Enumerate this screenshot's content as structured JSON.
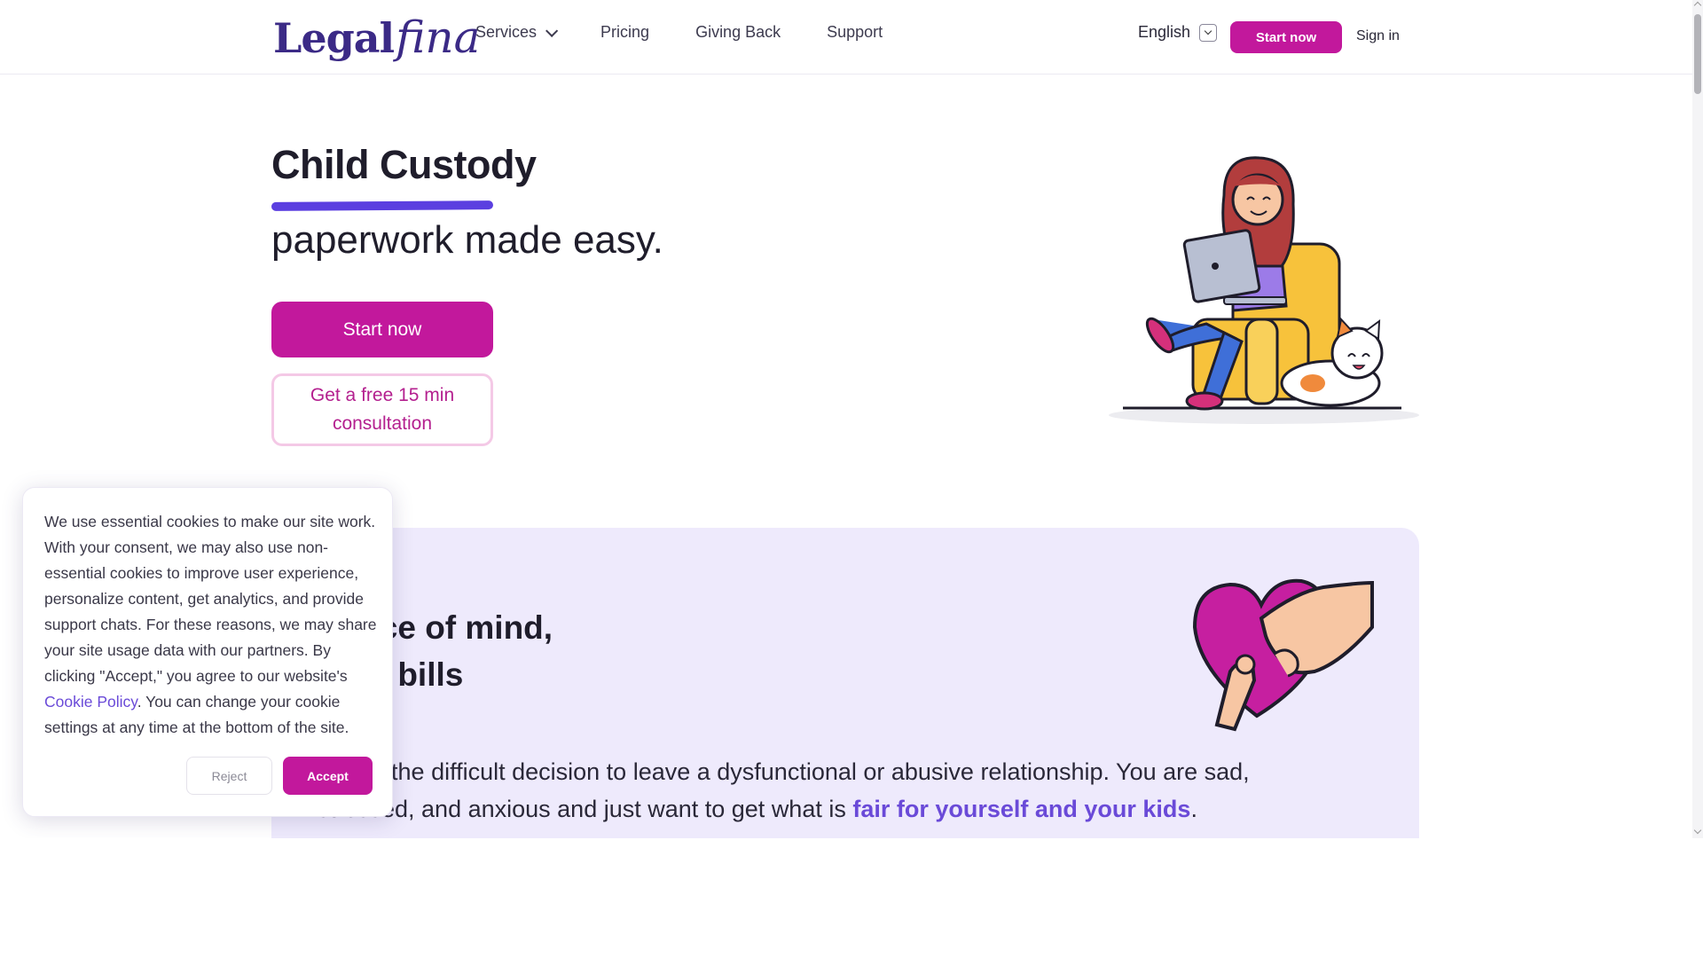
{
  "header": {
    "logo_part1": "Legal",
    "logo_part2": "fina",
    "nav": [
      {
        "label": "Services",
        "has_dropdown": true
      },
      {
        "label": "Pricing"
      },
      {
        "label": "Giving Back"
      },
      {
        "label": "Support"
      }
    ],
    "language": "English",
    "start_label": "Start now",
    "signin_label": "Sign in"
  },
  "hero": {
    "title": "Child Custody",
    "subtitle": "paperwork made easy.",
    "start_label": "Start now",
    "consult_line1": "Get a free 15 min",
    "consult_line2": "consultation"
  },
  "section": {
    "heading_line1": "peace of mind,",
    "heading_line2": "egal bills",
    "para_part1": "made the difficult decision to leave a dysfunctional or abusive relationship. You are sad,",
    "para_part2": "stressed, and anxious and just want to get what is ",
    "para_highlight": "fair for yourself and your kids",
    "para_end": "."
  },
  "cookie": {
    "text_before_link": "We use essential cookies to make our site work. With your consent, we may also use non-essential cookies to improve user experience, personalize content, get analytics, and provide support chats. For these reasons, we may share your site usage data with our partners. By clicking \"Accept,\" you agree to our website's ",
    "link_label": "Cookie Policy",
    "text_after_link": ". You can change your cookie settings at any time at the bottom of the site.",
    "reject_label": "Reject",
    "accept_label": "Accept"
  },
  "colors": {
    "brand": "#c2189c",
    "logo": "#3b2a86",
    "accent": "#5b3fe0",
    "section_bg": "#eeeafc"
  }
}
